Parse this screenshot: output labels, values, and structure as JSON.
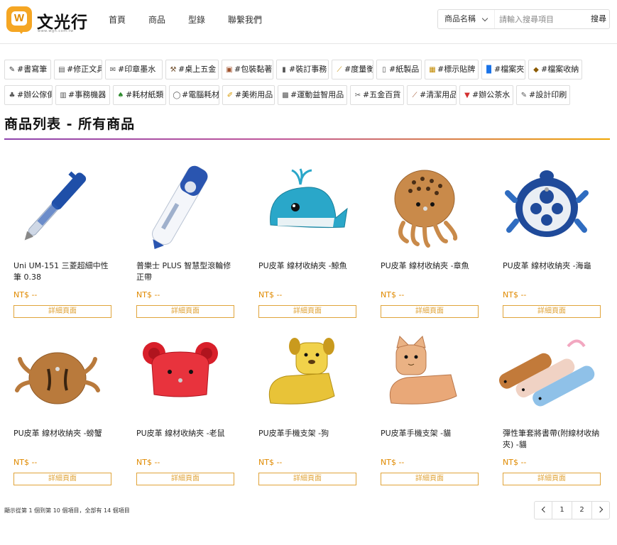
{
  "logo": {
    "name": "文光行",
    "url": "www.wgn.com.tw",
    "badge_letter": "W",
    "color": "#f5a623"
  },
  "nav": [
    "首頁",
    "商品",
    "型錄",
    "聯繫我們"
  ],
  "search": {
    "select_value": "商品名稱",
    "placeholder": "請輸入搜尋項目",
    "button": "搜尋"
  },
  "tags_row1": [
    {
      "label": "#書寫筆",
      "icon": "pen-icon"
    },
    {
      "label": "#修正文具",
      "icon": "correction-icon"
    },
    {
      "label": "#印章墨水",
      "icon": "stamp-icon"
    },
    {
      "label": "#桌上五金",
      "icon": "hammer-icon"
    },
    {
      "label": "#包裝黏著",
      "icon": "package-icon"
    },
    {
      "label": "#裝訂事務",
      "icon": "stapler-icon"
    },
    {
      "label": "#度量衡",
      "icon": "ruler-icon"
    },
    {
      "label": "#紙製品",
      "icon": "paper-icon"
    },
    {
      "label": "#標示貼牌",
      "icon": "label-icon"
    },
    {
      "label": "#檔案夾",
      "icon": "folder-icon"
    },
    {
      "label": "#檔案收納",
      "icon": "storage-icon"
    }
  ],
  "tags_row2": [
    {
      "label": "#辦公傢俱",
      "icon": "furniture-icon"
    },
    {
      "label": "#事務機器",
      "icon": "machine-icon"
    },
    {
      "label": "#耗材紙類",
      "icon": "tree-icon"
    },
    {
      "label": "#電腦耗材",
      "icon": "mouse-icon"
    },
    {
      "label": "#美術用品",
      "icon": "pencil-icon"
    },
    {
      "label": "#運動益智用品",
      "icon": "sports-icon"
    },
    {
      "label": "#五金百貨",
      "icon": "tools-icon"
    },
    {
      "label": "#清潔用品",
      "icon": "broom-icon"
    },
    {
      "label": "#辦公茶水",
      "icon": "cup-icon"
    },
    {
      "label": "#設計印刷",
      "icon": "design-icon"
    }
  ],
  "section": {
    "title": "商品列表 - 所有商品"
  },
  "products": [
    {
      "name": "Uni UM-151 三菱超細中性筆 0.38",
      "price": "NT$ --",
      "button": "詳細頁面",
      "image": "blue-gel-pen"
    },
    {
      "name": "普樂士 PLUS 智慧型滾輪修正帶",
      "price": "NT$ --",
      "button": "詳細頁面",
      "image": "correction-tape"
    },
    {
      "name": "PU皮革 線材收納夾 -鯨魚",
      "price": "NT$ --",
      "button": "詳細頁面",
      "image": "whale-clip"
    },
    {
      "name": "PU皮革 線材收納夾 -章魚",
      "price": "NT$ --",
      "button": "詳細頁面",
      "image": "octopus-clip"
    },
    {
      "name": "PU皮革 線材收納夾 -海龜",
      "price": "NT$ --",
      "button": "詳細頁面",
      "image": "turtle-clip"
    },
    {
      "name": "PU皮革 線材收納夾 -螃蟹",
      "price": "NT$ --",
      "button": "詳細頁面",
      "image": "crab-clip"
    },
    {
      "name": "PU皮革 線材收納夾 -老鼠",
      "price": "NT$ --",
      "button": "詳細頁面",
      "image": "mouse-clip"
    },
    {
      "name": "PU皮革手機支架 -狗",
      "price": "NT$ --",
      "button": "詳細頁面",
      "image": "dog-stand"
    },
    {
      "name": "PU皮革手機支架 -貓",
      "price": "NT$ --",
      "button": "詳細頁面",
      "image": "cat-stand"
    },
    {
      "name": "彈性筆套將書帶(附線材收納夾) -貓",
      "price": "NT$ --",
      "button": "詳細頁面",
      "image": "cat-pen-sleeves"
    }
  ],
  "footer": {
    "info": "顯示從第 1 個到第 10 個項目，全部有 14 個項目"
  },
  "pagination": {
    "pages": [
      "1",
      "2"
    ]
  },
  "colors": {
    "accent": "#e0a43a",
    "price": "#e08a00",
    "title_gradient": [
      "#8e44ad",
      "#f0a500"
    ]
  }
}
